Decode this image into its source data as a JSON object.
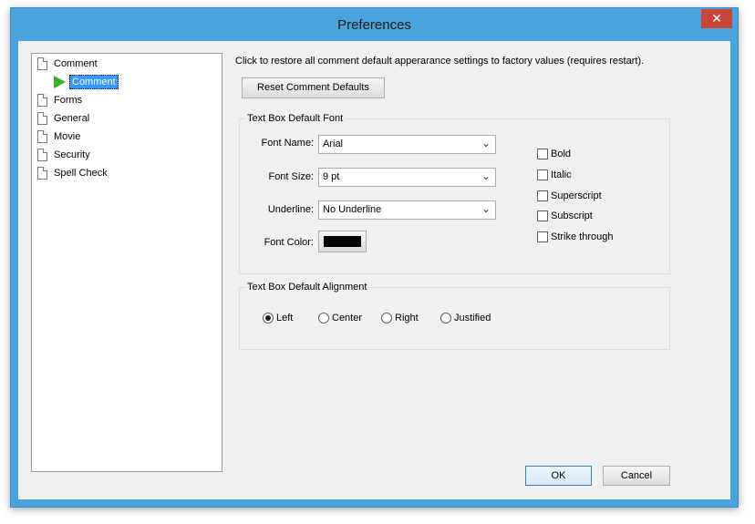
{
  "window": {
    "title": "Preferences",
    "close_glyph": "✕"
  },
  "tree": {
    "items": [
      {
        "label": "Comment",
        "icon": "page-icon"
      },
      {
        "label": "Comment",
        "icon": "green-arrow-icon",
        "selected": true
      },
      {
        "label": "Forms",
        "icon": "page-icon"
      },
      {
        "label": "General",
        "icon": "page-icon"
      },
      {
        "label": "Movie",
        "icon": "page-icon"
      },
      {
        "label": "Security",
        "icon": "page-icon"
      },
      {
        "label": "Spell Check",
        "icon": "page-icon"
      }
    ]
  },
  "hint": "Click to restore all comment default apperarance settings to factory values (requires restart).",
  "reset_button": "Reset Comment Defaults",
  "font_group": {
    "legend": "Text Box Default Font",
    "font_name_label": "Font Name:",
    "font_name_value": "Arial",
    "font_size_label": "Font Size:",
    "font_size_value": "9 pt",
    "underline_label": "Underline:",
    "underline_value": "No Underline",
    "font_color_label": "Font Color:",
    "font_color": "#000000",
    "checkboxes": [
      {
        "label": "Bold",
        "checked": false
      },
      {
        "label": "Italic",
        "checked": false
      },
      {
        "label": "Superscript",
        "checked": false
      },
      {
        "label": "Subscript",
        "checked": false
      },
      {
        "label": "Strike through",
        "checked": false
      }
    ]
  },
  "align_group": {
    "legend": "Text Box Default Alignment",
    "options": [
      {
        "label": "Left",
        "selected": true
      },
      {
        "label": "Center",
        "selected": false
      },
      {
        "label": "Right",
        "selected": false
      },
      {
        "label": "Justified",
        "selected": false
      }
    ]
  },
  "buttons": {
    "ok": "OK",
    "cancel": "Cancel"
  },
  "colors": {
    "title_bar": "#4aa3dc",
    "close_button": "#c7463a",
    "selection": "#3399ff",
    "arrow": "#3cb02c"
  }
}
